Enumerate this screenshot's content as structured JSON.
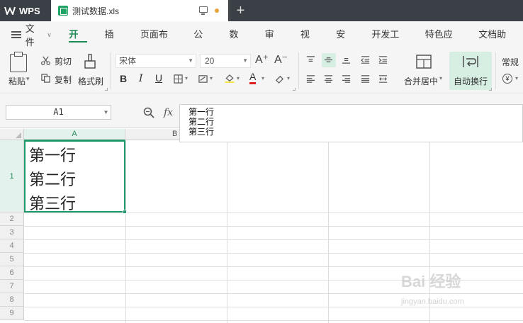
{
  "titlebar": {
    "app_name": "WPS",
    "document_tab": "测试数据.xls",
    "new_tab": "+"
  },
  "menubar": {
    "file_label": "文件",
    "items": [
      {
        "label": "开始",
        "active": true
      },
      {
        "label": "插入",
        "active": false
      },
      {
        "label": "页面布局",
        "active": false
      },
      {
        "label": "公式",
        "active": false
      },
      {
        "label": "数据",
        "active": false
      },
      {
        "label": "审阅",
        "active": false
      },
      {
        "label": "视图",
        "active": false
      },
      {
        "label": "安全",
        "active": false
      },
      {
        "label": "开发工具",
        "active": false
      },
      {
        "label": "特色应用",
        "active": false
      },
      {
        "label": "文档助手",
        "active": false
      }
    ]
  },
  "ribbon": {
    "paste_label": "粘贴",
    "cut_label": "剪切",
    "copy_label": "复制",
    "format_painter_label": "格式刷",
    "font_name": "宋体",
    "font_size": "20",
    "bold": "B",
    "italic": "I",
    "underline": "U",
    "font_color_letter": "A",
    "merge_center_label": "合并居中",
    "wrap_text_label": "自动换行",
    "number_format": "常规",
    "currency_symbol": "¥"
  },
  "formula_bar": {
    "name_box": "A1",
    "fx_label": "fx",
    "content_lines": [
      "第一行",
      "第二行",
      "第三行"
    ]
  },
  "grid": {
    "columns": [
      "A",
      "B"
    ],
    "rows": [
      "1",
      "2",
      "3",
      "4",
      "5",
      "6",
      "7",
      "8",
      "9"
    ],
    "a1_lines": [
      "第一行",
      "第二行",
      "第三行"
    ]
  },
  "watermark": {
    "text": "Bai 经验",
    "url": "jingyan.baidu.com"
  },
  "colors": {
    "accent": "#1e8a53",
    "selection": "#1f9a6a",
    "titlebar": "#3b3f46"
  }
}
